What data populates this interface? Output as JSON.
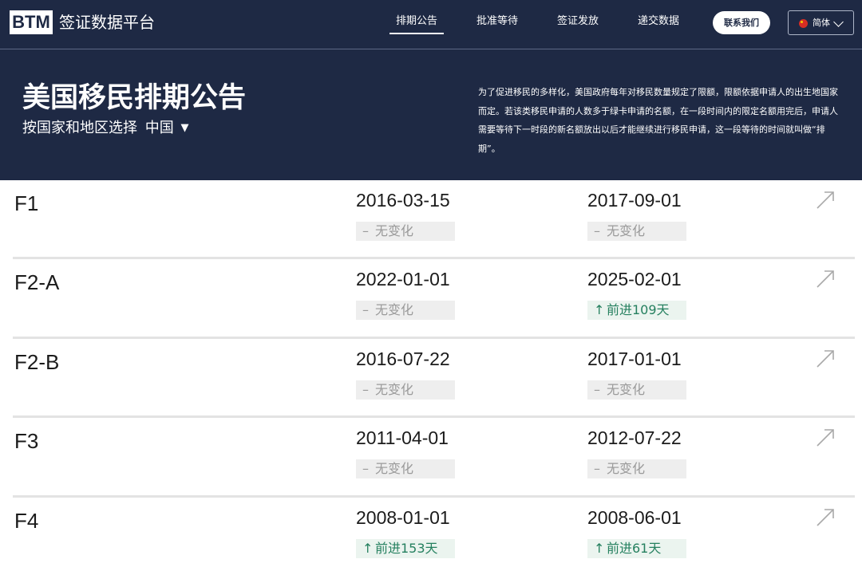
{
  "nav": {
    "logo": "BTM",
    "brand": "签证数据平台",
    "items": [
      {
        "label": "排期公告",
        "active": true
      },
      {
        "label": "批准等待",
        "active": false
      },
      {
        "label": "签证发放",
        "active": false
      },
      {
        "label": "递交数据",
        "active": false
      }
    ],
    "contact_label": "联系我们",
    "language": {
      "label": "简体",
      "flag_icon": "china-flag-icon"
    }
  },
  "hero": {
    "title": "美国移民排期公告",
    "region_prompt": "按国家和地区选择",
    "region_value": "中国",
    "region_caret": "▼",
    "description": "为了促进移民的多样化，美国政府每年对移民数量规定了限额，限额依据申请人的出生地国家而定。若该类移民申请的人数多于绿卡申请的名额，在一段时间内的限定名额用完后，申请人需要等待下一时段的新名额放出以后才能继续进行移民申请，这一段等待的时间就叫做“排期”。"
  },
  "colors": {
    "header_bg": "#1e2944",
    "positive": "#25805f",
    "neutral": "#9a9a9a"
  },
  "rows": [
    {
      "category": "F1",
      "date1": "2016-03-15",
      "change1": {
        "type": "neutral",
        "symbol": "–",
        "label": "无变化"
      },
      "date2": "2017-09-01",
      "change2": {
        "type": "neutral",
        "symbol": "–",
        "label": "无变化"
      },
      "link_icon": "arrow-up-right-icon"
    },
    {
      "category": "F2-A",
      "date1": "2022-01-01",
      "change1": {
        "type": "neutral",
        "symbol": "–",
        "label": "无变化"
      },
      "date2": "2025-02-01",
      "change2": {
        "type": "up",
        "symbol": "↑",
        "label": "前进109天"
      },
      "link_icon": "arrow-up-right-icon"
    },
    {
      "category": "F2-B",
      "date1": "2016-07-22",
      "change1": {
        "type": "neutral",
        "symbol": "–",
        "label": "无变化"
      },
      "date2": "2017-01-01",
      "change2": {
        "type": "neutral",
        "symbol": "–",
        "label": "无变化"
      },
      "link_icon": "arrow-up-right-icon"
    },
    {
      "category": "F3",
      "date1": "2011-04-01",
      "change1": {
        "type": "neutral",
        "symbol": "–",
        "label": "无变化"
      },
      "date2": "2012-07-22",
      "change2": {
        "type": "neutral",
        "symbol": "–",
        "label": "无变化"
      },
      "link_icon": "arrow-up-right-icon"
    },
    {
      "category": "F4",
      "date1": "2008-01-01",
      "change1": {
        "type": "up",
        "symbol": "↑",
        "label": "前进153天"
      },
      "date2": "2008-06-01",
      "change2": {
        "type": "up",
        "symbol": "↑",
        "label": "前进61天"
      },
      "link_icon": "arrow-up-right-icon"
    }
  ]
}
